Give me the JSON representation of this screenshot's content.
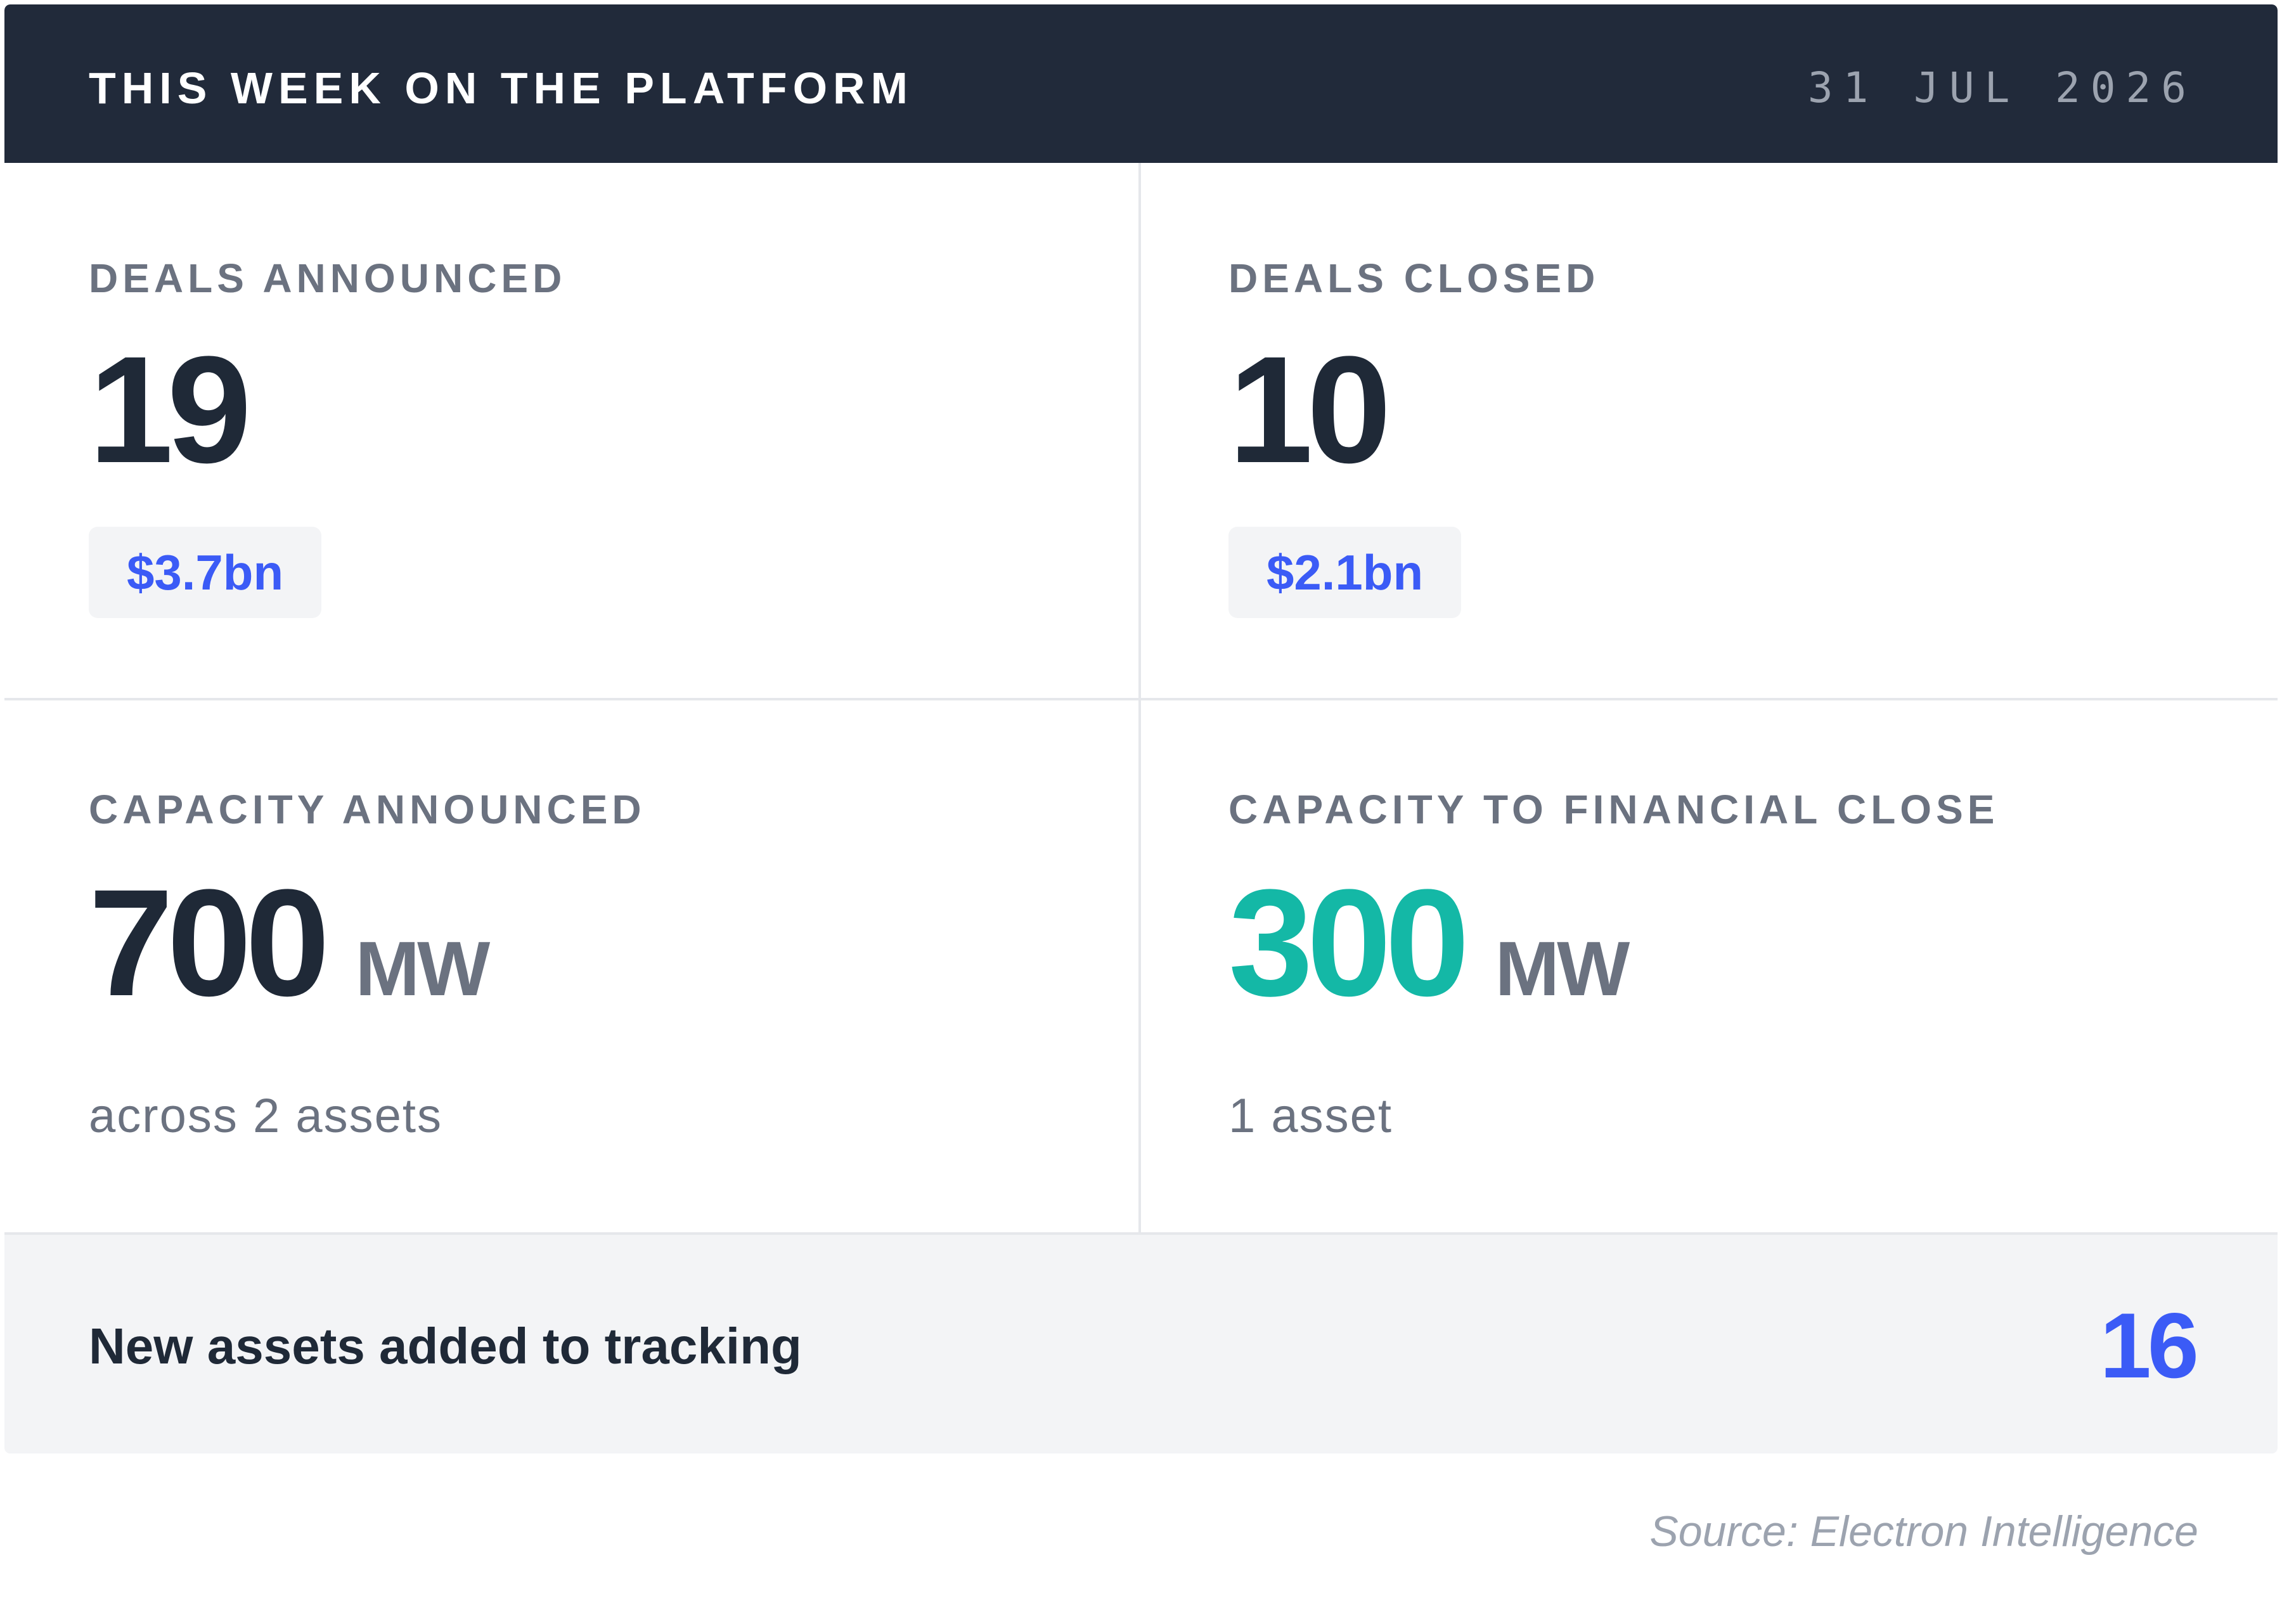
{
  "header": {
    "title": "THIS WEEK ON THE PLATFORM",
    "date": "31 JUL 2026"
  },
  "stats": {
    "deals_announced": {
      "label": "DEALS ANNOUNCED",
      "count": "19",
      "value": "$3.7bn"
    },
    "deals_closed": {
      "label": "DEALS CLOSED",
      "count": "10",
      "value": "$2.1bn"
    },
    "capacity_announced": {
      "label": "CAPACITY ANNOUNCED",
      "amount": "700",
      "unit": "MW",
      "note": "across 2 assets"
    },
    "capacity_financial_close": {
      "label": "CAPACITY TO FINANCIAL CLOSE",
      "amount": "300",
      "unit": "MW",
      "note": "1 asset"
    }
  },
  "footer": {
    "label": "New assets added to tracking",
    "value": "16"
  },
  "source": "Source: Electron Intelligence",
  "colors": {
    "header_bg": "#212a3a",
    "text_dark": "#1f2937",
    "text_muted": "#6b7280",
    "accent_blue": "#3b5bf6",
    "accent_teal": "#14b8a6",
    "panel_bg": "#f3f4f6",
    "divider": "#e5e7eb"
  }
}
